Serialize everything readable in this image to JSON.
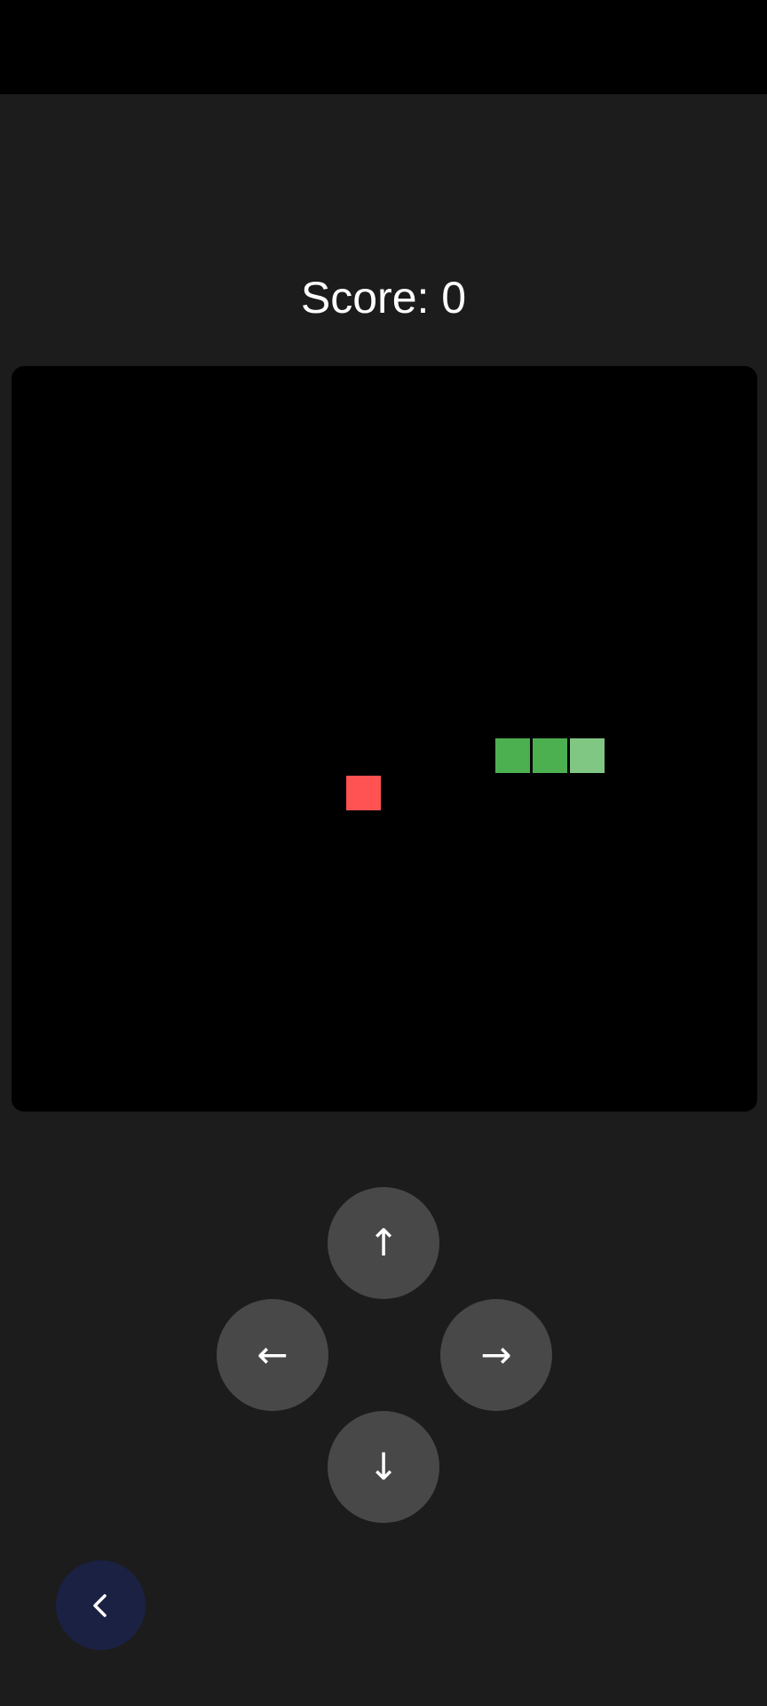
{
  "score": {
    "text": "Score: 0"
  },
  "board": {
    "background": "#000000",
    "food_color": "#ff5252",
    "snake_body_color": "#4caf50",
    "snake_head_color": "#81c784",
    "snake_length": 3
  },
  "controls": {
    "up_label": "↑",
    "left_label": "←",
    "right_label": "→",
    "down_label": "↓",
    "button_color": "#484848"
  },
  "back": {
    "icon": "chevron-left-icon",
    "color": "#1a2142"
  }
}
